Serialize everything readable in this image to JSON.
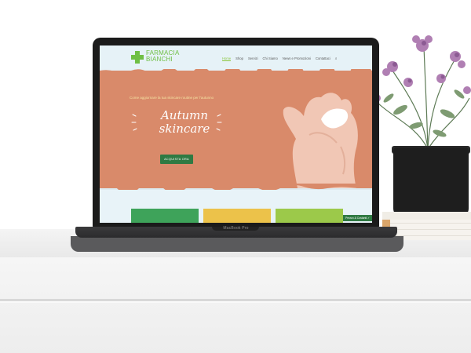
{
  "site": {
    "logo_line1": "FARMACIA",
    "logo_line2": "BIANCHI",
    "nav": [
      "Home",
      "Shop",
      "Servizi",
      "Chi Siamo",
      "News e Promozioni",
      "Contattaci"
    ],
    "nav_active": "Home",
    "hero_subtitle": "Come aggiornare la tua skincare routine per l'autunno",
    "hero_title_line1": "Autumn",
    "hero_title_line2": "skincare",
    "hero_button": "ACQUISTA ORA",
    "promo_tab": "Prezzo & Costanti ✓",
    "colors": {
      "brand_green": "#6fbf44",
      "button_green": "#2f7a43",
      "hero_bg": "#d98a6a",
      "card_green": "#3ea35a",
      "card_yellow": "#ecc24a",
      "card_lime": "#9cc94a"
    }
  },
  "laptop": {
    "label": "MacBook Pro"
  },
  "icons": {
    "search": "search-icon",
    "logo_cross": "pharmacy-cross-icon"
  }
}
